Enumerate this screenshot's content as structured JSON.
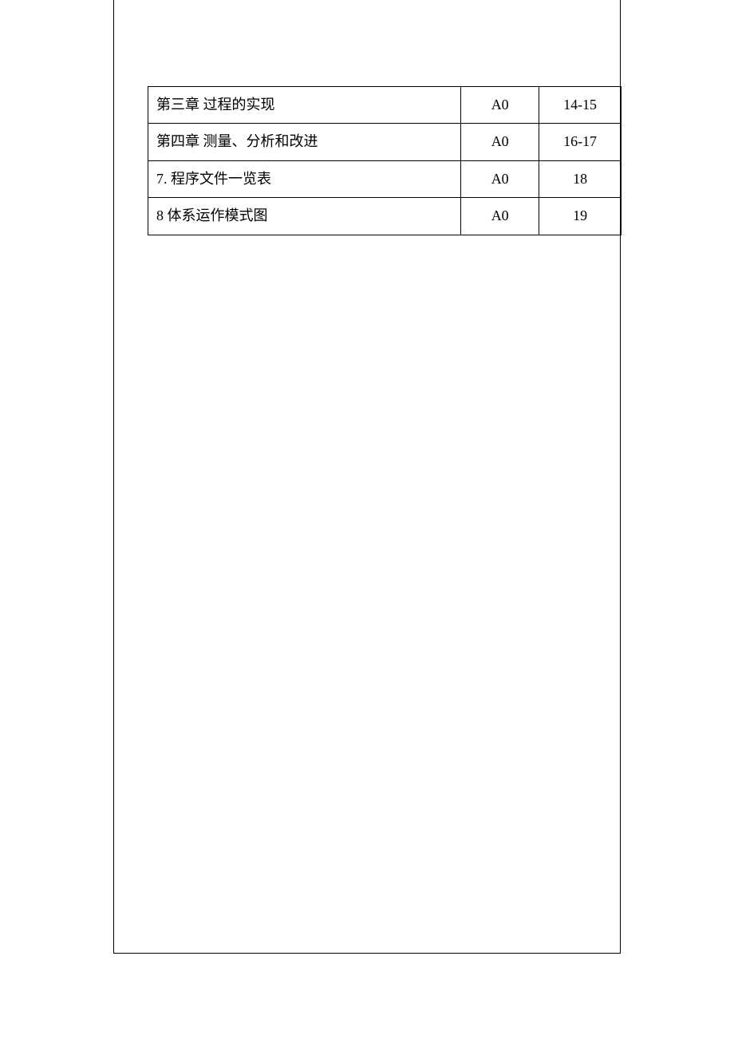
{
  "table": {
    "rows": [
      {
        "title": "第三章  过程的实现",
        "code": "A0",
        "page": "14-15"
      },
      {
        "title": "第四章  测量、分析和改进",
        "code": "A0",
        "page": "16-17"
      },
      {
        "title": "7.    程序文件一览表",
        "code": "A0",
        "page": "18"
      },
      {
        "title": "8 体系运作模式图",
        "code": "A0",
        "page": "19"
      }
    ]
  }
}
